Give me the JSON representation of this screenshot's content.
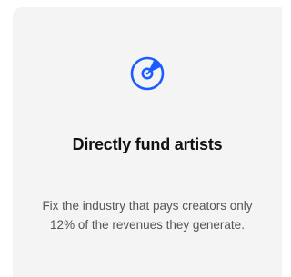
{
  "feature_card": {
    "icon": "vinyl-record-icon",
    "accent_color": "#1a5cff",
    "title": "Directly fund artists",
    "description": "Fix the industry that pays creators only 12% of the revenues they generate."
  }
}
